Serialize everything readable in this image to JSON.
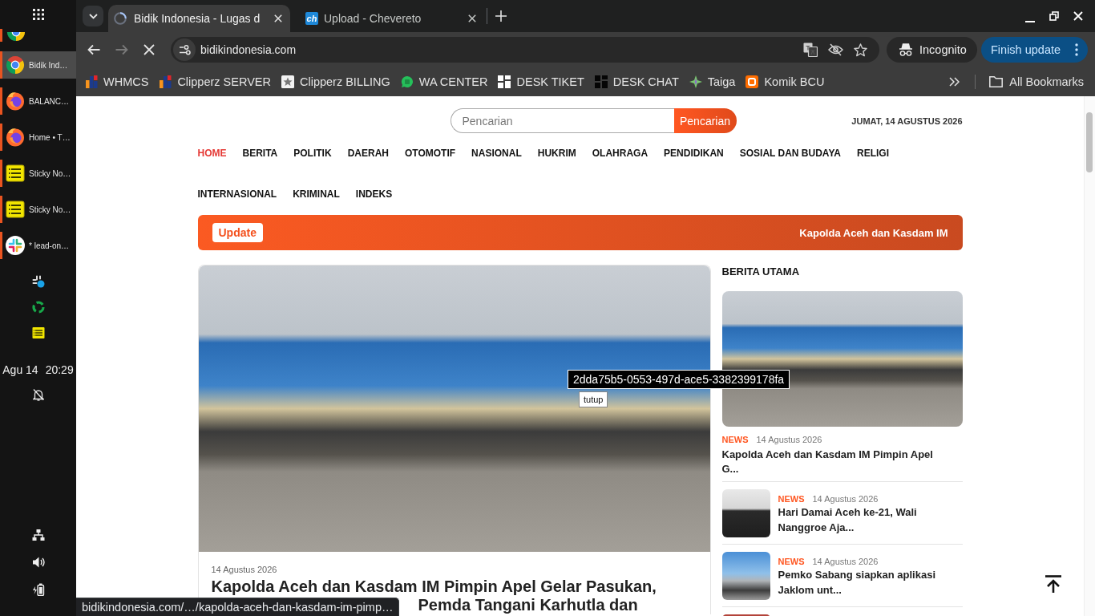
{
  "dock": {
    "items": [
      {
        "kind": "ring",
        "label": "Bidik Ind…",
        "selected": true
      },
      {
        "kind": "flame",
        "label": "BALANC…",
        "selected": false
      },
      {
        "kind": "flame",
        "label": "Home • T…",
        "selected": false
      },
      {
        "kind": "note",
        "label": "Sticky No…",
        "selected": false
      },
      {
        "kind": "note",
        "label": "Sticky No…",
        "selected": false
      },
      {
        "kind": "pinwheel",
        "label": "* lead-on…",
        "selected": false
      }
    ],
    "tray": [
      {
        "kind": "pinwheel"
      },
      {
        "kind": "recycle"
      },
      {
        "kind": "note"
      }
    ],
    "date": "Agu 14",
    "time": "20:29",
    "status_icons": [
      {
        "kind": "network"
      },
      {
        "kind": "volume"
      },
      {
        "kind": "battery"
      }
    ]
  },
  "browser": {
    "tabs": [
      {
        "kind": "spinner",
        "title": "Bidik Indonesia - Lugas d",
        "selected": true
      },
      {
        "kind": "logo",
        "logo_text": "ch",
        "title": "Upload - Chevereto",
        "selected": false
      }
    ],
    "nav_buttons": [
      {
        "kind": "back",
        "disabled": false
      },
      {
        "kind": "forward",
        "disabled": true
      },
      {
        "kind": "stop",
        "disabled": false
      }
    ],
    "url": "bidikindonesia.com",
    "profile": "Incognito",
    "update_button": "Finish update",
    "bookmarks": [
      {
        "kind": "bars",
        "label": "WHMCS"
      },
      {
        "kind": "bars",
        "label": "Clipperz SERVER"
      },
      {
        "kind": "star-tile",
        "label": "Clipperz BILLING"
      },
      {
        "kind": "chat",
        "label": "WA CENTER"
      },
      {
        "kind": "blocks",
        "label": "DESK TIKET"
      },
      {
        "kind": "blocks-dark",
        "label": "DESK CHAT"
      },
      {
        "kind": "sparkle",
        "label": "Taiga"
      },
      {
        "kind": "orange-tile",
        "label": "Komik BCU"
      }
    ],
    "all_bookmarks": "All Bookmarks",
    "status_url": "bidikindonesia.com/…/kapolda-aceh-dan-kasdam-im-pimp…"
  },
  "page": {
    "search": {
      "placeholder": "Pencarian",
      "button": "Pencarian"
    },
    "date": "JUMAT, 14 AGUSTUS 2026",
    "nav": [
      {
        "label": "HOME",
        "selected": true
      },
      {
        "label": "BERITA",
        "selected": false
      },
      {
        "label": "POLITIK",
        "selected": false
      },
      {
        "label": "DAERAH",
        "selected": false
      },
      {
        "label": "OTOMOTIF",
        "selected": false
      },
      {
        "label": "NASIONAL",
        "selected": false
      },
      {
        "label": "HUKRIM",
        "selected": false
      },
      {
        "label": "OLAHRAGA",
        "selected": false
      },
      {
        "label": "PENDIDIKAN",
        "selected": false
      },
      {
        "label": "SOSIAL DAN BUDAYA",
        "selected": false
      },
      {
        "label": "RELIGI",
        "selected": false
      },
      {
        "label": "INTERNASIONAL",
        "selected": false
      },
      {
        "label": "KRIMINAL",
        "selected": false
      },
      {
        "label": "INDEKS",
        "selected": false
      }
    ],
    "ticker": {
      "badge": "Update",
      "headline": "Kapolda Aceh dan Kasdam IM"
    },
    "featured": {
      "date": "14 Agustus 2026",
      "headline": "Kapolda Aceh dan Kasdam IM Pimpin Apel Gelar Pasukan,",
      "headline_continued": "Pemda Tangani Karhutla dan"
    },
    "image_tooltip": {
      "id": "2dda75b5-0553-497d-ace5-3382399178fa",
      "hint": "tutup"
    },
    "sidebar": {
      "title": "BERITA UTAMA",
      "items": [
        {
          "kind": "large",
          "category": "NEWS",
          "date": "14 Agustus 2026",
          "title": "Kapolda Aceh dan Kasdam IM Pimpin Apel G..."
        },
        {
          "kind": "thumb",
          "category": "NEWS",
          "date": "14 Agustus 2026",
          "title": "Hari Damai Aceh ke-21, Wali Nanggroe Aja..."
        },
        {
          "kind": "thumb",
          "category": "NEWS",
          "date": "14 Agustus 2026",
          "title": "Pemko Sabang siapkan aplikasi Jaklom unt..."
        }
      ]
    }
  }
}
